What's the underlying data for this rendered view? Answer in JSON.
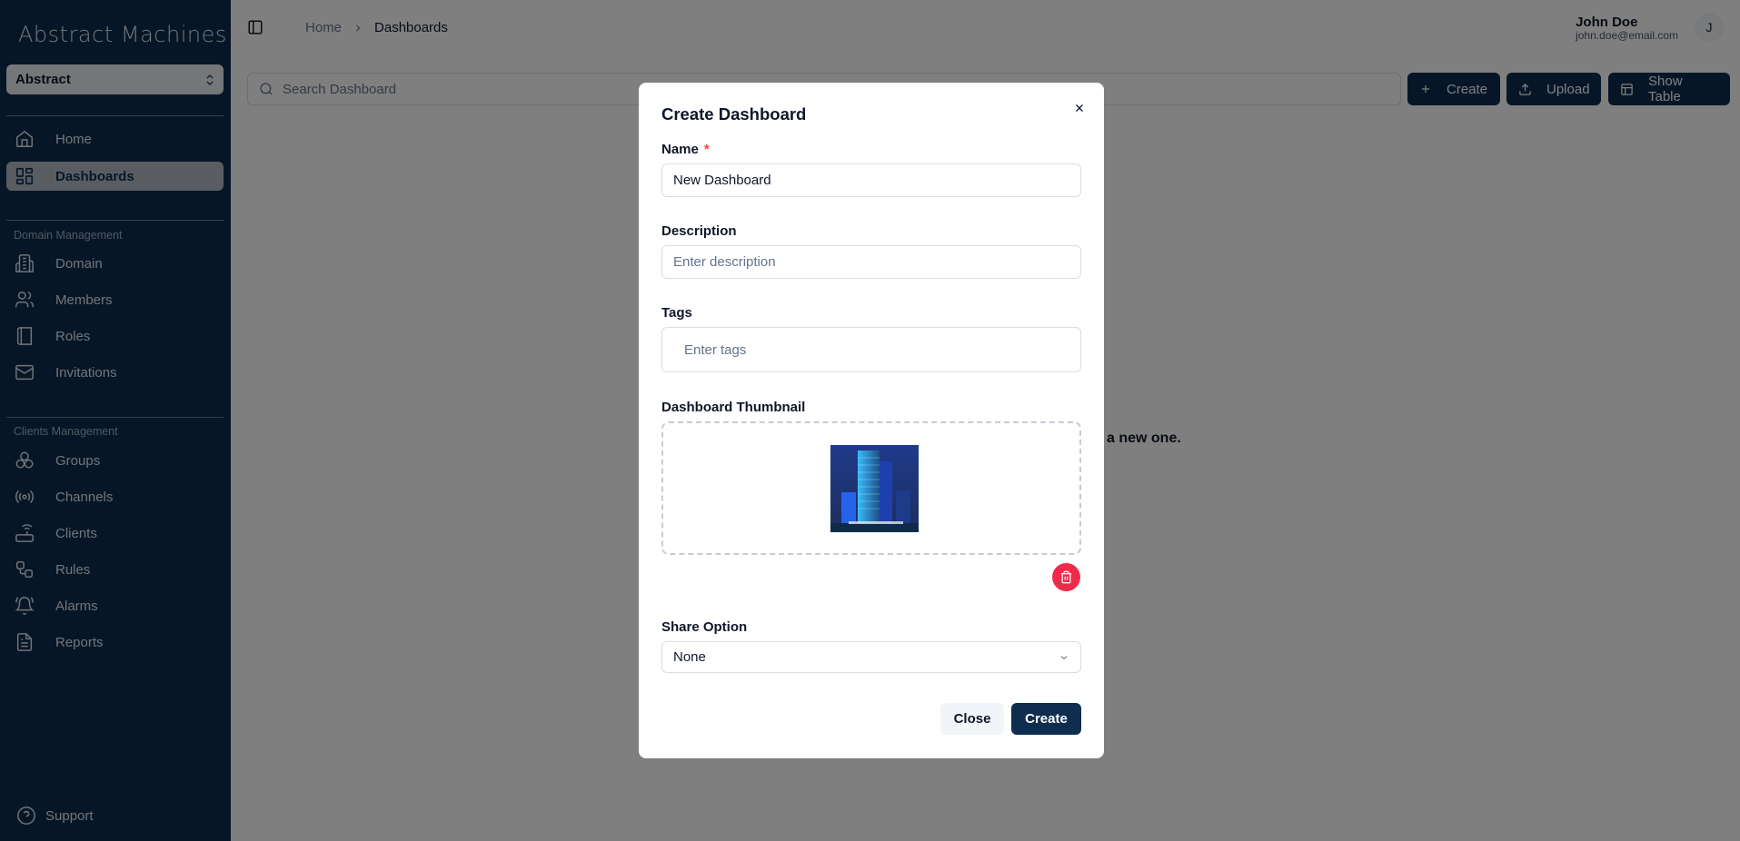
{
  "sidebar": {
    "logo": "Abstract Machines",
    "domain_select": "Abstract",
    "items_top": [
      {
        "label": "Home",
        "icon": "home-icon"
      },
      {
        "label": "Dashboards",
        "icon": "dashboard-icon",
        "active": true
      }
    ],
    "section_domain": "Domain Management",
    "items_domain": [
      {
        "label": "Domain",
        "icon": "building-icon"
      },
      {
        "label": "Members",
        "icon": "users-icon"
      },
      {
        "label": "Roles",
        "icon": "book-icon"
      },
      {
        "label": "Invitations",
        "icon": "mail-icon"
      }
    ],
    "section_clients": "Clients Management",
    "items_clients": [
      {
        "label": "Groups",
        "icon": "groups-icon"
      },
      {
        "label": "Channels",
        "icon": "broadcast-icon"
      },
      {
        "label": "Clients",
        "icon": "router-icon"
      },
      {
        "label": "Rules",
        "icon": "workflow-icon"
      },
      {
        "label": "Alarms",
        "icon": "bell-icon"
      },
      {
        "label": "Reports",
        "icon": "file-icon"
      }
    ],
    "support": "Support"
  },
  "header": {
    "breadcrumb": [
      "Home",
      "Dashboards"
    ],
    "user_name": "John Doe",
    "user_email": "john.doe@email.com",
    "avatar_initial": "J"
  },
  "toolbar": {
    "search_placeholder": "Search Dashboard",
    "create_label": "Create",
    "upload_label": "Upload",
    "show_table_label": "Show Table"
  },
  "main": {
    "empty_text": "a new one."
  },
  "modal": {
    "title": "Create Dashboard",
    "name_label": "Name",
    "name_required": "*",
    "name_value": "New Dashboard",
    "description_label": "Description",
    "description_placeholder": "Enter description",
    "tags_label": "Tags",
    "tags_placeholder": "Enter tags",
    "thumbnail_label": "Dashboard Thumbnail",
    "share_label": "Share Option",
    "share_value": "None",
    "close_label": "Close",
    "create_label": "Create"
  },
  "colors": {
    "sidebar_bg": "#0e2d4f",
    "primary": "#0e2d4f",
    "danger": "#ef2b4a",
    "active_item_bg": "#b3bbc4"
  }
}
